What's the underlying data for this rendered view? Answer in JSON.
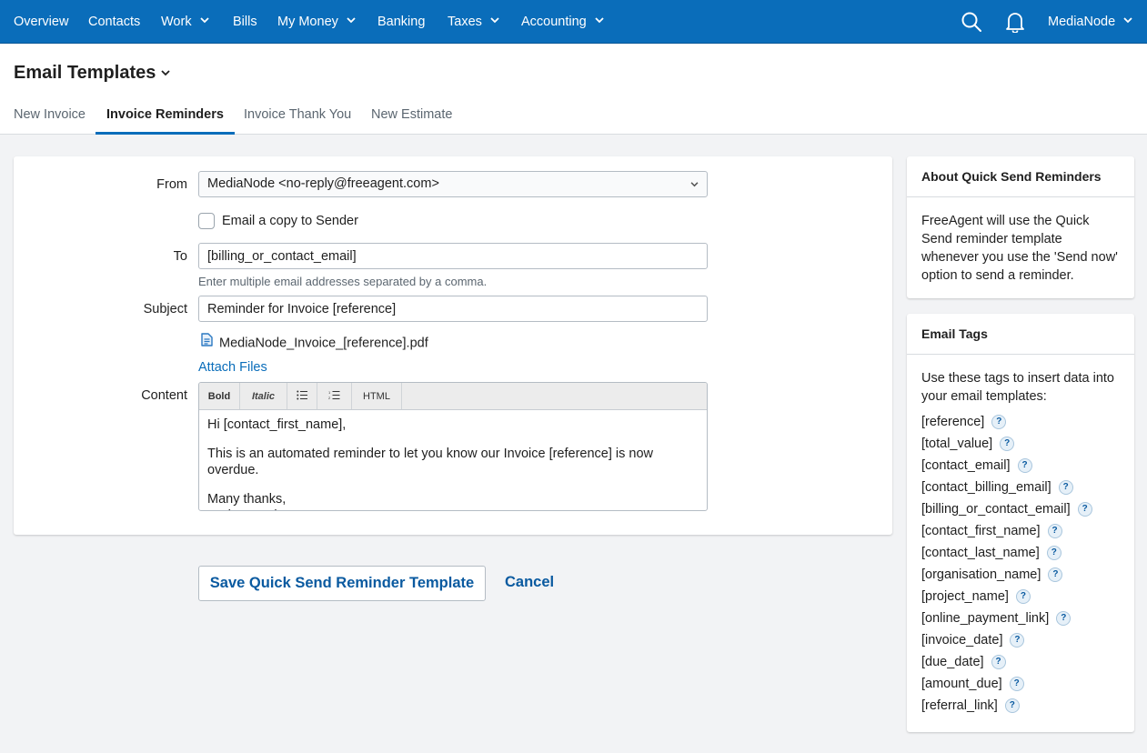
{
  "nav": {
    "items": [
      {
        "label": "Overview",
        "has_dropdown": false
      },
      {
        "label": "Contacts",
        "has_dropdown": false
      },
      {
        "label": "Work",
        "has_dropdown": true
      },
      {
        "label": "Bills",
        "has_dropdown": false
      },
      {
        "label": "My Money",
        "has_dropdown": true
      },
      {
        "label": "Banking",
        "has_dropdown": false
      },
      {
        "label": "Taxes",
        "has_dropdown": true
      },
      {
        "label": "Accounting",
        "has_dropdown": true
      }
    ],
    "search_icon": "search-icon",
    "bell_icon": "bell-icon",
    "account_label": "MediaNode"
  },
  "header": {
    "title": "Email Templates",
    "tabs": [
      {
        "label": "New Invoice",
        "active": false
      },
      {
        "label": "Invoice Reminders",
        "active": true
      },
      {
        "label": "Invoice Thank You",
        "active": false
      },
      {
        "label": "New Estimate",
        "active": false
      }
    ]
  },
  "form": {
    "from_label": "From",
    "from_value": "MediaNode <no-reply@freeagent.com>",
    "copy_sender_label": "Email a copy to Sender",
    "copy_sender_checked": false,
    "to_label": "To",
    "to_value": "[billing_or_contact_email]",
    "to_hint": "Enter multiple email addresses separated by a comma.",
    "subject_label": "Subject",
    "subject_value": "Reminder for Invoice [reference]",
    "attachment": "MediaNode_Invoice_[reference].pdf",
    "attach_files_label": "Attach Files",
    "content_label": "Content",
    "toolbar": {
      "bold": "Bold",
      "italic": "Italic",
      "bullet_list_icon": "bullet-list-icon",
      "numbered_list_icon": "numbered-list-icon",
      "html": "HTML"
    },
    "content": {
      "greeting": "Hi [contact_first_name],",
      "body": "This is an automated reminder to let you know our Invoice [reference] is now overdue.",
      "signoff": "Many thanks,",
      "signature": "Nathan Barley"
    }
  },
  "actions": {
    "save_label": "Save Quick Send Reminder Template",
    "cancel_label": "Cancel"
  },
  "sidebar": {
    "about": {
      "title": "About Quick Send Reminders",
      "body": "FreeAgent will use the Quick Send reminder template whenever you use the 'Send now' option to send a reminder."
    },
    "tags": {
      "title": "Email Tags",
      "intro": "Use these tags to insert data into your email templates:",
      "items": [
        "[reference]",
        "[total_value]",
        "[contact_email]",
        "[contact_billing_email]",
        "[billing_or_contact_email]",
        "[contact_first_name]",
        "[contact_last_name]",
        "[organisation_name]",
        "[project_name]",
        "[online_payment_link]",
        "[invoice_date]",
        "[due_date]",
        "[amount_due]",
        "[referral_link]"
      ],
      "help_glyph": "?"
    }
  },
  "colors": {
    "brand_blue": "#0a6dba",
    "link_blue": "#0a5aa0",
    "background": "#f2f3f5"
  }
}
